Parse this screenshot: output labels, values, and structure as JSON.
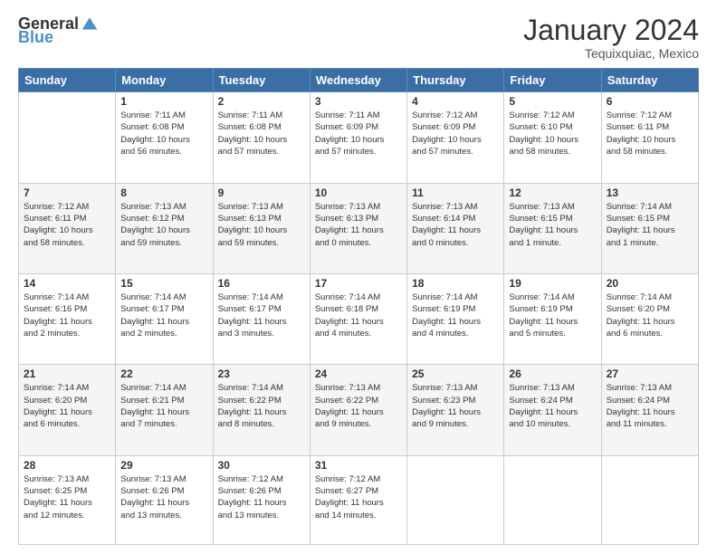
{
  "logo": {
    "general": "General",
    "blue": "Blue"
  },
  "title": "January 2024",
  "location": "Tequixquiac, Mexico",
  "weekdays": [
    "Sunday",
    "Monday",
    "Tuesday",
    "Wednesday",
    "Thursday",
    "Friday",
    "Saturday"
  ],
  "weeks": [
    [
      {
        "day": "",
        "info": ""
      },
      {
        "day": "1",
        "info": "Sunrise: 7:11 AM\nSunset: 6:08 PM\nDaylight: 10 hours\nand 56 minutes."
      },
      {
        "day": "2",
        "info": "Sunrise: 7:11 AM\nSunset: 6:08 PM\nDaylight: 10 hours\nand 57 minutes."
      },
      {
        "day": "3",
        "info": "Sunrise: 7:11 AM\nSunset: 6:09 PM\nDaylight: 10 hours\nand 57 minutes."
      },
      {
        "day": "4",
        "info": "Sunrise: 7:12 AM\nSunset: 6:09 PM\nDaylight: 10 hours\nand 57 minutes."
      },
      {
        "day": "5",
        "info": "Sunrise: 7:12 AM\nSunset: 6:10 PM\nDaylight: 10 hours\nand 58 minutes."
      },
      {
        "day": "6",
        "info": "Sunrise: 7:12 AM\nSunset: 6:11 PM\nDaylight: 10 hours\nand 58 minutes."
      }
    ],
    [
      {
        "day": "7",
        "info": "Sunrise: 7:12 AM\nSunset: 6:11 PM\nDaylight: 10 hours\nand 58 minutes."
      },
      {
        "day": "8",
        "info": "Sunrise: 7:13 AM\nSunset: 6:12 PM\nDaylight: 10 hours\nand 59 minutes."
      },
      {
        "day": "9",
        "info": "Sunrise: 7:13 AM\nSunset: 6:13 PM\nDaylight: 10 hours\nand 59 minutes."
      },
      {
        "day": "10",
        "info": "Sunrise: 7:13 AM\nSunset: 6:13 PM\nDaylight: 11 hours\nand 0 minutes."
      },
      {
        "day": "11",
        "info": "Sunrise: 7:13 AM\nSunset: 6:14 PM\nDaylight: 11 hours\nand 0 minutes."
      },
      {
        "day": "12",
        "info": "Sunrise: 7:13 AM\nSunset: 6:15 PM\nDaylight: 11 hours\nand 1 minute."
      },
      {
        "day": "13",
        "info": "Sunrise: 7:14 AM\nSunset: 6:15 PM\nDaylight: 11 hours\nand 1 minute."
      }
    ],
    [
      {
        "day": "14",
        "info": "Sunrise: 7:14 AM\nSunset: 6:16 PM\nDaylight: 11 hours\nand 2 minutes."
      },
      {
        "day": "15",
        "info": "Sunrise: 7:14 AM\nSunset: 6:17 PM\nDaylight: 11 hours\nand 2 minutes."
      },
      {
        "day": "16",
        "info": "Sunrise: 7:14 AM\nSunset: 6:17 PM\nDaylight: 11 hours\nand 3 minutes."
      },
      {
        "day": "17",
        "info": "Sunrise: 7:14 AM\nSunset: 6:18 PM\nDaylight: 11 hours\nand 4 minutes."
      },
      {
        "day": "18",
        "info": "Sunrise: 7:14 AM\nSunset: 6:19 PM\nDaylight: 11 hours\nand 4 minutes."
      },
      {
        "day": "19",
        "info": "Sunrise: 7:14 AM\nSunset: 6:19 PM\nDaylight: 11 hours\nand 5 minutes."
      },
      {
        "day": "20",
        "info": "Sunrise: 7:14 AM\nSunset: 6:20 PM\nDaylight: 11 hours\nand 6 minutes."
      }
    ],
    [
      {
        "day": "21",
        "info": "Sunrise: 7:14 AM\nSunset: 6:20 PM\nDaylight: 11 hours\nand 6 minutes."
      },
      {
        "day": "22",
        "info": "Sunrise: 7:14 AM\nSunset: 6:21 PM\nDaylight: 11 hours\nand 7 minutes."
      },
      {
        "day": "23",
        "info": "Sunrise: 7:14 AM\nSunset: 6:22 PM\nDaylight: 11 hours\nand 8 minutes."
      },
      {
        "day": "24",
        "info": "Sunrise: 7:13 AM\nSunset: 6:22 PM\nDaylight: 11 hours\nand 9 minutes."
      },
      {
        "day": "25",
        "info": "Sunrise: 7:13 AM\nSunset: 6:23 PM\nDaylight: 11 hours\nand 9 minutes."
      },
      {
        "day": "26",
        "info": "Sunrise: 7:13 AM\nSunset: 6:24 PM\nDaylight: 11 hours\nand 10 minutes."
      },
      {
        "day": "27",
        "info": "Sunrise: 7:13 AM\nSunset: 6:24 PM\nDaylight: 11 hours\nand 11 minutes."
      }
    ],
    [
      {
        "day": "28",
        "info": "Sunrise: 7:13 AM\nSunset: 6:25 PM\nDaylight: 11 hours\nand 12 minutes."
      },
      {
        "day": "29",
        "info": "Sunrise: 7:13 AM\nSunset: 6:26 PM\nDaylight: 11 hours\nand 13 minutes."
      },
      {
        "day": "30",
        "info": "Sunrise: 7:12 AM\nSunset: 6:26 PM\nDaylight: 11 hours\nand 13 minutes."
      },
      {
        "day": "31",
        "info": "Sunrise: 7:12 AM\nSunset: 6:27 PM\nDaylight: 11 hours\nand 14 minutes."
      },
      {
        "day": "",
        "info": ""
      },
      {
        "day": "",
        "info": ""
      },
      {
        "day": "",
        "info": ""
      }
    ]
  ]
}
